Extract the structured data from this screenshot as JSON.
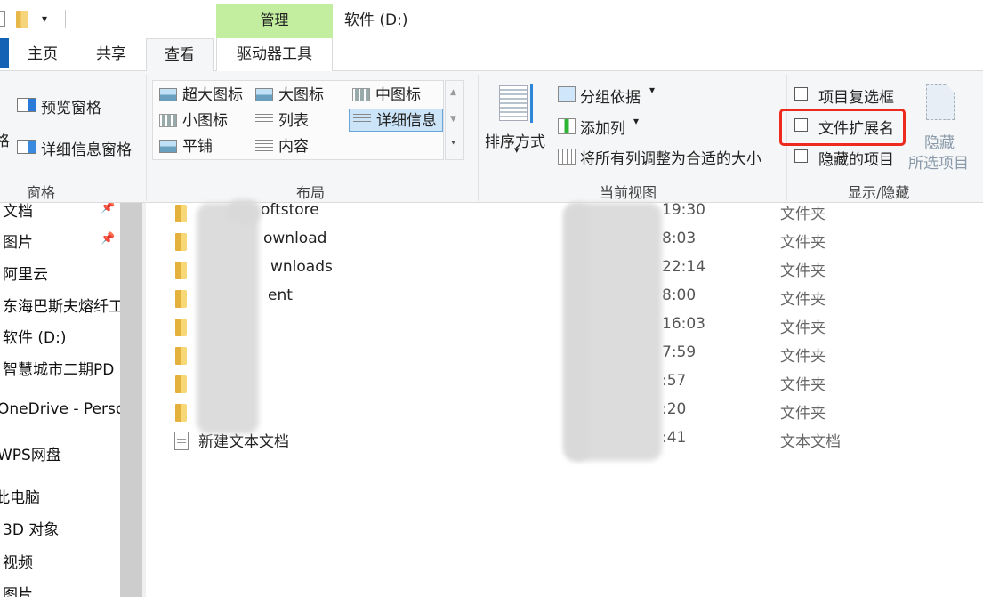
{
  "titlebar": {
    "context_tab": "管理",
    "window_title": "软件 (D:)",
    "quick_access_dropdown": "▾"
  },
  "tabs": [
    {
      "label": "主页"
    },
    {
      "label": "共享"
    },
    {
      "label": "查看",
      "active": true
    },
    {
      "label": "驱动器工具"
    }
  ],
  "ribbon": {
    "panes": {
      "group_label": "窗格",
      "clipped_label": "格",
      "preview_pane": "预览窗格",
      "details_pane": "详细信息窗格"
    },
    "layout": {
      "group_label": "布局",
      "items": [
        {
          "label": "超大图标",
          "icon": "extra-large-icons-icon"
        },
        {
          "label": "大图标",
          "icon": "large-icons-icon"
        },
        {
          "label": "中图标",
          "icon": "medium-icons-icon"
        },
        {
          "label": "小图标",
          "icon": "small-icons-icon"
        },
        {
          "label": "列表",
          "icon": "list-icon"
        },
        {
          "label": "详细信息",
          "icon": "details-icon",
          "selected": true
        },
        {
          "label": "平铺",
          "icon": "tiles-icon"
        },
        {
          "label": "内容",
          "icon": "content-icon"
        }
      ],
      "scroll_up": "▲",
      "scroll_down": "▼",
      "expand": "⯆"
    },
    "current_view": {
      "group_label": "当前视图",
      "sort_by": "排序方式",
      "group_by": "分组依据",
      "add_columns": "添加列",
      "size_columns": "将所有列调整为合适的大小",
      "dropdown_arrow": "▾"
    },
    "show_hide": {
      "group_label": "显示/隐藏",
      "item_checkboxes": {
        "label": "项目复选框",
        "checked": false
      },
      "file_extensions": {
        "label": "文件扩展名",
        "checked": false
      },
      "hidden_items": {
        "label": "隐藏的项目",
        "checked": false
      },
      "hide_selected_line1": "隐藏",
      "hide_selected_line2": "所选项目"
    },
    "highlight_color": "#ee2a1f"
  },
  "nav": {
    "items": [
      {
        "label": "文档",
        "pinned": true
      },
      {
        "label": "图片",
        "pinned": true
      },
      {
        "label": "阿里云"
      },
      {
        "label": "东海巴斯夫熔纤工"
      },
      {
        "label": "软件 (D:)"
      },
      {
        "label": "智慧城市二期PD"
      },
      {
        "label": "OneDrive - Perso"
      },
      {
        "label": "WPS网盘"
      },
      {
        "label": "此电脑"
      },
      {
        "label": "3D 对象"
      },
      {
        "label": "视频"
      },
      {
        "label": "图片"
      }
    ],
    "pin_glyph": "📌"
  },
  "files": [
    {
      "name": "oftstore",
      "time": "19:30",
      "type": "文件夹",
      "kind": "folder"
    },
    {
      "name": "ownload",
      "time": "8:03",
      "type": "文件夹",
      "kind": "folder"
    },
    {
      "name": "wnloads",
      "time": "22:14",
      "type": "文件夹",
      "kind": "folder"
    },
    {
      "name": "ent",
      "time": "8:00",
      "type": "文件夹",
      "kind": "folder"
    },
    {
      "name": "",
      "time": "16:03",
      "type": "文件夹",
      "kind": "folder"
    },
    {
      "name": "",
      "time": "7:59",
      "type": "文件夹",
      "kind": "folder"
    },
    {
      "name": "",
      "time": ":57",
      "type": "文件夹",
      "kind": "folder"
    },
    {
      "name": "",
      "time": ":20",
      "type": "文件夹",
      "kind": "folder"
    },
    {
      "name": "新建文本文档",
      "time": ":41",
      "type": "文本文档",
      "kind": "text"
    }
  ]
}
